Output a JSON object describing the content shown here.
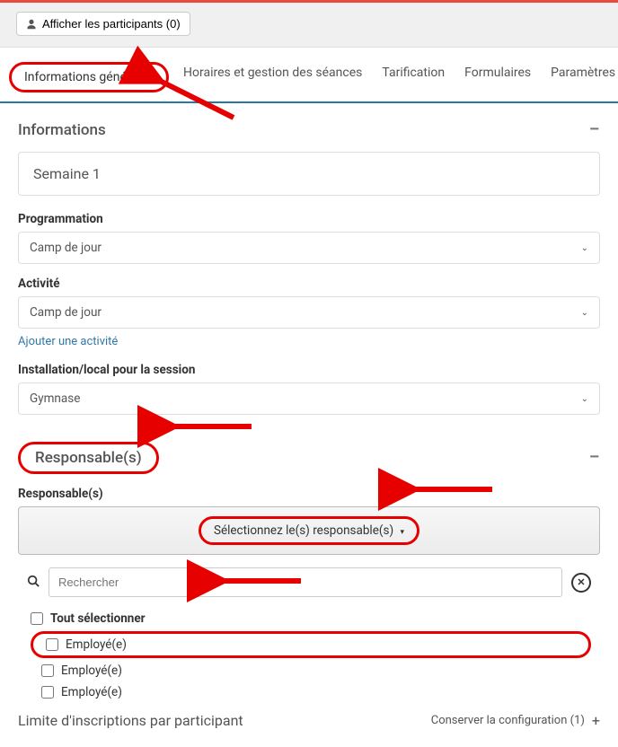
{
  "header": {
    "participants_btn": "Afficher les participants (0)"
  },
  "tabs": {
    "general": "Informations générales",
    "schedule": "Horaires et gestion des séances",
    "pricing": "Tarification",
    "forms": "Formulaires",
    "advanced": "Paramètres avancés"
  },
  "sections": {
    "informations": "Informations",
    "responsables": "Responsable(s)",
    "limit": "Limite d'inscriptions par participant"
  },
  "form": {
    "session_name": "Semaine 1",
    "programmation_label": "Programmation",
    "programmation_value": "Camp de jour",
    "activite_label": "Activité",
    "activite_value": "Camp de jour",
    "add_activity_link": "Ajouter une activité",
    "installation_label": "Installation/local pour la session",
    "installation_value": "Gymnase"
  },
  "responsables": {
    "label": "Responsable(s)",
    "select_btn": "Sélectionnez le(s) responsable(s)",
    "search_placeholder": "Rechercher",
    "select_all": "Tout sélectionner",
    "options": [
      "Employé(e)",
      "Employé(e)",
      "Employé(e)"
    ]
  },
  "footer": {
    "conserve": "Conserver la configuration (1)"
  }
}
